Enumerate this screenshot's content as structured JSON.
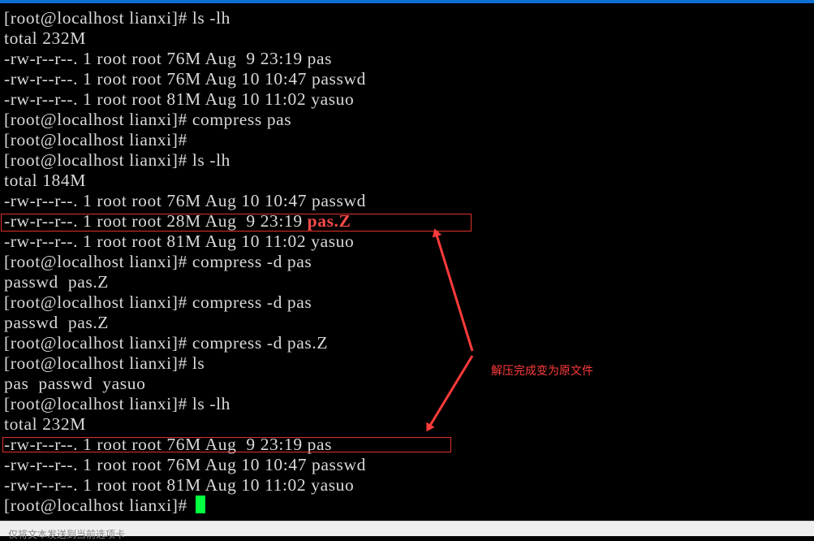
{
  "terminal": {
    "lines": [
      "[root@localhost lianxi]# ls -lh",
      "total 232M",
      "-rw-r--r--. 1 root root 76M Aug  9 23:19 pas",
      "-rw-r--r--. 1 root root 76M Aug 10 10:47 passwd",
      "-rw-r--r--. 1 root root 81M Aug 10 11:02 yasuo",
      "[root@localhost lianxi]# compress pas",
      "[root@localhost lianxi]#",
      "[root@localhost lianxi]# ls -lh",
      "total 184M",
      "-rw-r--r--. 1 root root 76M Aug 10 10:47 passwd",
      "-rw-r--r--. 1 root root 28M Aug  9 23:19 ",
      "-rw-r--r--. 1 root root 81M Aug 10 11:02 yasuo",
      "[root@localhost lianxi]# compress -d pas",
      "passwd  pas.Z",
      "[root@localhost lianxi]# compress -d pas",
      "passwd  pas.Z",
      "[root@localhost lianxi]# compress -d pas.Z",
      "[root@localhost lianxi]# ls",
      "pas  passwd  yasuo",
      "[root@localhost lianxi]# ls -lh",
      "total 232M",
      "-rw-r--r--. 1 root root 76M Aug  9 23:19 pas",
      "-rw-r--r--. 1 root root 76M Aug 10 10:47 passwd",
      "-rw-r--r--. 1 root root 81M Aug 10 11:02 yasuo",
      "[root@localhost lianxi]# "
    ],
    "highlighted_filename": "pas.Z",
    "prompt": "[root@localhost lianxi]#"
  },
  "annotation": {
    "note": "解压完成变为原文件",
    "color": "#ff3b3b"
  },
  "statusbar": {
    "text": "仅将文本发送到当前选项卡"
  },
  "colors": {
    "background": "#000000",
    "text": "#d9d9d9",
    "cursor": "#00ff40",
    "highlight": "#ff4a4a"
  }
}
